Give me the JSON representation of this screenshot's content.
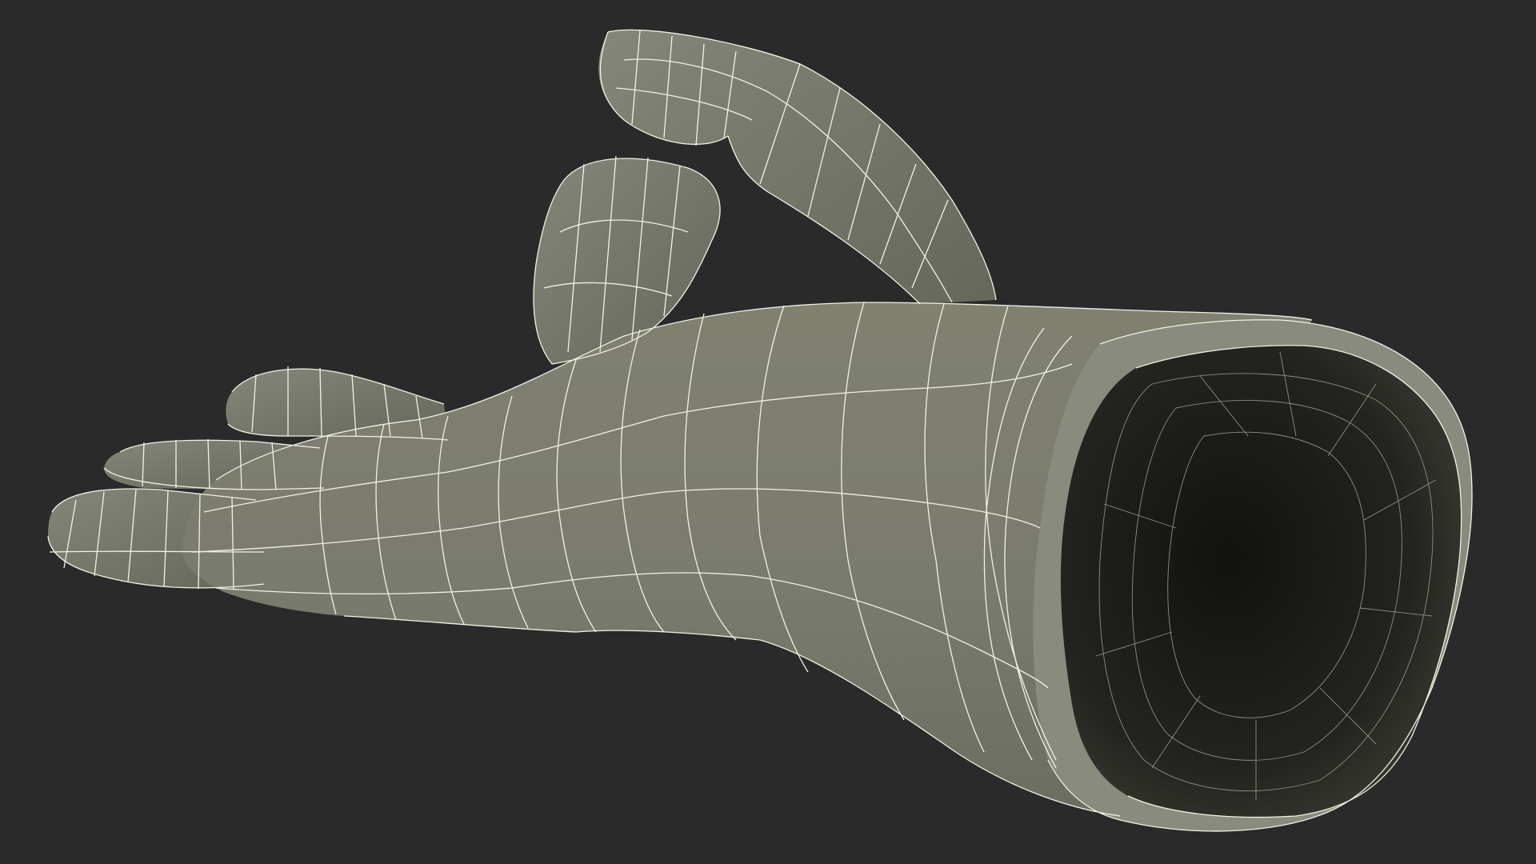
{
  "scene": {
    "subject": "hand-glove-wireframe-model",
    "background_color": "#2a2a2a",
    "surface_color": "#7b7c70",
    "surface_shadow_color": "#5f6057",
    "interior_color": "#1e1f1b",
    "wire_color": "#f1f1e3"
  }
}
